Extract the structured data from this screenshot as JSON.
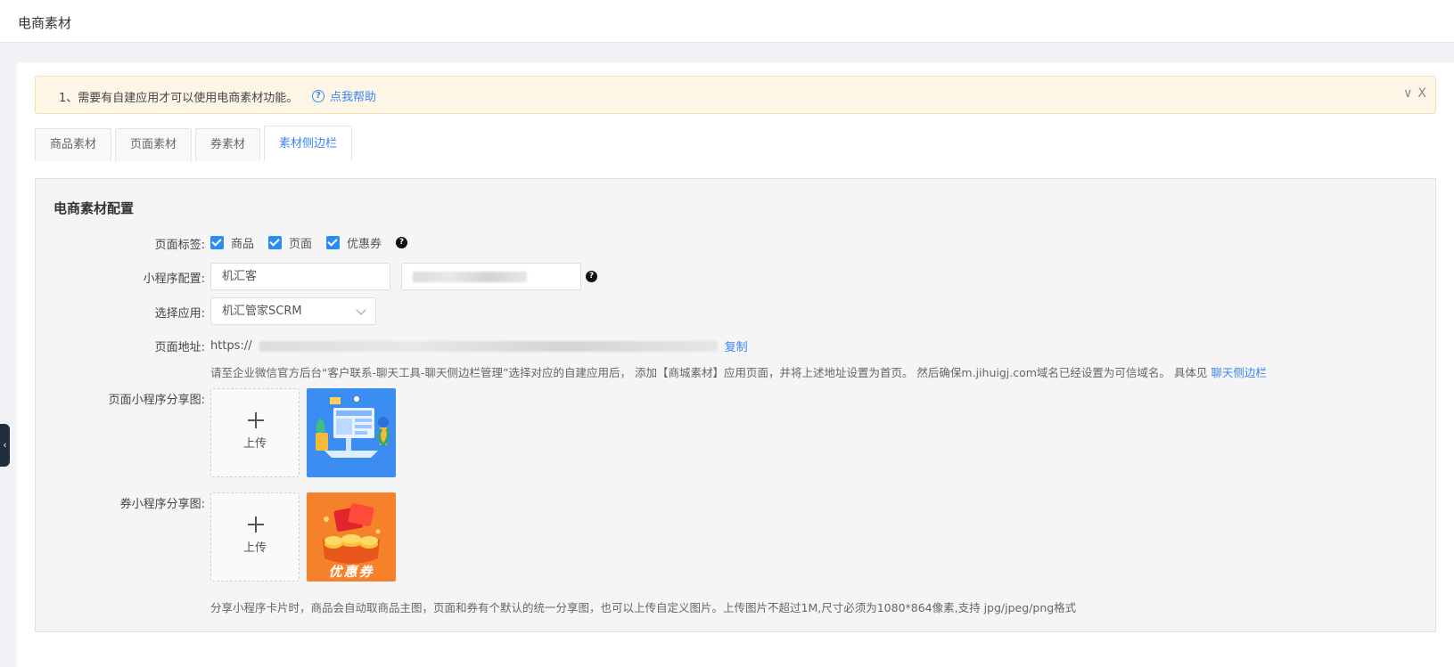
{
  "header": {
    "title": "电商素材"
  },
  "notice": {
    "message": "1、需要有自建应用才可以使用电商素材功能。",
    "help_icon": "?",
    "help_label": "点我帮助",
    "collapse_glyph": "∨",
    "close_glyph": "X"
  },
  "tabs": [
    {
      "label": "商品素材"
    },
    {
      "label": "页面素材"
    },
    {
      "label": "券素材"
    },
    {
      "label": "素材侧边栏",
      "active": true
    }
  ],
  "config": {
    "heading": "电商素材配置",
    "page_tags": {
      "label": "页面标签:",
      "options": [
        "商品",
        "页面",
        "优惠券"
      ],
      "help_glyph": "?"
    },
    "miniprogram": {
      "label": "小程序配置:",
      "name_value": "机汇客",
      "help_glyph": "?"
    },
    "app_select": {
      "label": "选择应用:",
      "value": "机汇管家SCRM"
    },
    "page_url": {
      "label": "页面地址:",
      "prefix": "https://",
      "copy_label": "复制",
      "hint": "请至企业微信官方后台“客户联系-聊天工具-聊天侧边栏管理”选择对应的自建应用后， 添加【商城素材】应用页面，并将上述地址设置为首页。 然后确保m.jihuigj.com域名已经设置为可信域名。 具体见",
      "hint_link": "聊天侧边栏"
    },
    "page_share": {
      "label": "页面小程序分享图:",
      "upload_label": "上传"
    },
    "coupon_share": {
      "label": "券小程序分享图:",
      "upload_label": "上传",
      "image_caption": "优惠券"
    },
    "footnote": "分享小程序卡片时，商品会自动取商品主图，页面和券有个默认的统一分享图，也可以上传自定义图片。上传图片不超过1M,尺寸必须为1080*864像素,支持 jpg/jpeg/png格式"
  },
  "side_handle_glyph": "‹",
  "colors": {
    "accent": "#3a86f5",
    "checkbox": "#2b8cf0",
    "notice_bg": "#fdf6e7"
  }
}
